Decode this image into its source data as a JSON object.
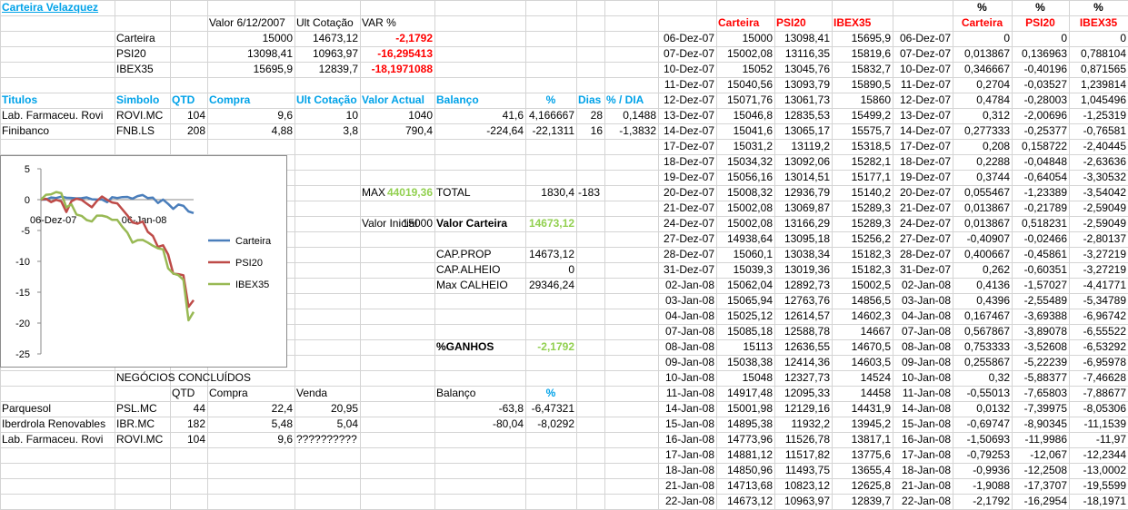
{
  "title": "Carteira Velazquez",
  "summary": {
    "headers": [
      "Valor 6/12/2007",
      "Ult Cotação",
      "VAR %"
    ],
    "rows": [
      {
        "name": "Carteira",
        "valor": "15000",
        "ult": "14673,12",
        "var": "-2,1792"
      },
      {
        "name": "PSI20",
        "valor": "13098,41",
        "ult": "10963,97",
        "var": "-16,295413"
      },
      {
        "name": "IBEX35",
        "valor": "15695,9",
        "ult": "12839,7",
        "var": "-18,1971088"
      }
    ]
  },
  "holdings": {
    "headers": [
      "Titulos",
      "Simbolo",
      "QTD",
      "Compra",
      "Ult Cotação",
      "Valor Actual",
      "Balanço",
      "%",
      "Dias",
      "% / DIA"
    ],
    "rows": [
      [
        "Lab. Farmaceu. Rovi",
        "ROVI.MC",
        "104",
        "9,6",
        "10",
        "1040",
        "41,6",
        "4,166667",
        "28",
        "0,1488"
      ],
      [
        "Finibanco",
        "FNB.LS",
        "208",
        "4,88",
        "3,8",
        "790,4",
        "-224,64",
        "-22,1311",
        "16",
        "-1,3832"
      ]
    ]
  },
  "stats": {
    "max_label": "MAX",
    "max_value": "44019,36",
    "total_label": "TOTAL",
    "total_value": "1830,4",
    "total_extra": "-183",
    "valor_inicial_label": "Valor Inicial",
    "valor_inicial": "15000",
    "valor_carteira_label": "Valor Carteira",
    "valor_carteira": "14673,12",
    "cap_prop_label": "CAP.PROP",
    "cap_prop": "14673,12",
    "cap_alheio_label": "CAP.ALHEIO",
    "cap_alheio": "0",
    "max_calheio_label": "Max CALHEIO",
    "max_calheio": "29346,24",
    "ganhos_label": "%GANHOS",
    "ganhos": "-2,1792"
  },
  "closed": {
    "title": "NEGÓCIOS CONCLUÍDOS",
    "headers": [
      "QTD",
      "Compra",
      "Venda",
      "Balanço",
      "%"
    ],
    "rows": [
      [
        "Parquesol",
        "PSL.MC",
        "44",
        "22,4",
        "20,95",
        "-63,8",
        "-6,47321"
      ],
      [
        "Iberdrola Renovables",
        "IBR.MC",
        "182",
        "5,48",
        "5,04",
        "-80,04",
        "-8,0292"
      ],
      [
        "Lab. Farmaceu. Rovi",
        "ROVI.MC",
        "104",
        "9,6",
        "??????????",
        "",
        ""
      ]
    ]
  },
  "history": {
    "headers": [
      "Carteira",
      "PSI20",
      "IBEX35"
    ],
    "pct_headers": [
      "Carteira",
      "PSI20",
      "IBEX35"
    ],
    "pct_mark": "%",
    "rows": [
      [
        "06-Dez-07",
        "15000",
        "13098,41",
        "15695,9",
        "06-Dez-07",
        "0",
        "0",
        "0"
      ],
      [
        "07-Dez-07",
        "15002,08",
        "13116,35",
        "15819,6",
        "07-Dez-07",
        "0,013867",
        "0,136963",
        "0,788104"
      ],
      [
        "10-Dez-07",
        "15052",
        "13045,76",
        "15832,7",
        "10-Dez-07",
        "0,346667",
        "-0,40196",
        "0,871565"
      ],
      [
        "11-Dez-07",
        "15040,56",
        "13093,79",
        "15890,5",
        "11-Dez-07",
        "0,2704",
        "-0,03527",
        "1,239814"
      ],
      [
        "12-Dez-07",
        "15071,76",
        "13061,73",
        "15860",
        "12-Dez-07",
        "0,4784",
        "-0,28003",
        "1,045496"
      ],
      [
        "13-Dez-07",
        "15046,8",
        "12835,53",
        "15499,2",
        "13-Dez-07",
        "0,312",
        "-2,00696",
        "-1,25319"
      ],
      [
        "14-Dez-07",
        "15041,6",
        "13065,17",
        "15575,7",
        "14-Dez-07",
        "0,277333",
        "-0,25377",
        "-0,76581"
      ],
      [
        "17-Dez-07",
        "15031,2",
        "13119,2",
        "15318,5",
        "17-Dez-07",
        "0,208",
        "0,158722",
        "-2,40445"
      ],
      [
        "18-Dez-07",
        "15034,32",
        "13092,06",
        "15282,1",
        "18-Dez-07",
        "0,2288",
        "-0,04848",
        "-2,63636"
      ],
      [
        "19-Dez-07",
        "15056,16",
        "13014,51",
        "15177,1",
        "19-Dez-07",
        "0,3744",
        "-0,64054",
        "-3,30532"
      ],
      [
        "20-Dez-07",
        "15008,32",
        "12936,79",
        "15140,2",
        "20-Dez-07",
        "0,055467",
        "-1,23389",
        "-3,54042"
      ],
      [
        "21-Dez-07",
        "15002,08",
        "13069,87",
        "15289,3",
        "21-Dez-07",
        "0,013867",
        "-0,21789",
        "-2,59049"
      ],
      [
        "24-Dez-07",
        "15002,08",
        "13166,29",
        "15289,3",
        "24-Dez-07",
        "0,013867",
        "0,518231",
        "-2,59049"
      ],
      [
        "27-Dez-07",
        "14938,64",
        "13095,18",
        "15256,2",
        "27-Dez-07",
        "-0,40907",
        "-0,02466",
        "-2,80137"
      ],
      [
        "28-Dez-07",
        "15060,1",
        "13038,34",
        "15182,3",
        "28-Dez-07",
        "0,400667",
        "-0,45861",
        "-3,27219"
      ],
      [
        "31-Dez-07",
        "15039,3",
        "13019,36",
        "15182,3",
        "31-Dez-07",
        "0,262",
        "-0,60351",
        "-3,27219"
      ],
      [
        "02-Jan-08",
        "15062,04",
        "12892,73",
        "15002,5",
        "02-Jan-08",
        "0,4136",
        "-1,57027",
        "-4,41771"
      ],
      [
        "03-Jan-08",
        "15065,94",
        "12763,76",
        "14856,5",
        "03-Jan-08",
        "0,4396",
        "-2,55489",
        "-5,34789"
      ],
      [
        "04-Jan-08",
        "15025,12",
        "12614,57",
        "14602,3",
        "04-Jan-08",
        "0,167467",
        "-3,69388",
        "-6,96742"
      ],
      [
        "07-Jan-08",
        "15085,18",
        "12588,78",
        "14667",
        "07-Jan-08",
        "0,567867",
        "-3,89078",
        "-6,55522"
      ],
      [
        "08-Jan-08",
        "15113",
        "12636,55",
        "14670,5",
        "08-Jan-08",
        "0,753333",
        "-3,52608",
        "-6,53292"
      ],
      [
        "09-Jan-08",
        "15038,38",
        "12414,36",
        "14603,5",
        "09-Jan-08",
        "0,255867",
        "-5,22239",
        "-6,95978"
      ],
      [
        "10-Jan-08",
        "15048",
        "12327,73",
        "14524",
        "10-Jan-08",
        "0,32",
        "-5,88377",
        "-7,46628"
      ],
      [
        "11-Jan-08",
        "14917,48",
        "12095,33",
        "14458",
        "11-Jan-08",
        "-0,55013",
        "-7,65803",
        "-7,88677"
      ],
      [
        "14-Jan-08",
        "15001,98",
        "12129,16",
        "14431,9",
        "14-Jan-08",
        "0,0132",
        "-7,39975",
        "-8,05306"
      ],
      [
        "15-Jan-08",
        "14895,38",
        "11932,2",
        "13945,2",
        "15-Jan-08",
        "-0,69747",
        "-8,90345",
        "-11,1539"
      ],
      [
        "16-Jan-08",
        "14773,96",
        "11526,78",
        "13817,1",
        "16-Jan-08",
        "-1,50693",
        "-11,9986",
        "-11,97"
      ],
      [
        "17-Jan-08",
        "14881,12",
        "11517,82",
        "13775,6",
        "17-Jan-08",
        "-0,79253",
        "-12,067",
        "-12,2344"
      ],
      [
        "18-Jan-08",
        "14850,96",
        "11493,75",
        "13655,4",
        "18-Jan-08",
        "-0,9936",
        "-12,2508",
        "-13,0002"
      ],
      [
        "21-Jan-08",
        "14713,68",
        "10823,12",
        "12625,8",
        "21-Jan-08",
        "-1,9088",
        "-17,3707",
        "-19,5599"
      ],
      [
        "22-Jan-08",
        "14673,12",
        "10963,97",
        "12839,7",
        "22-Jan-08",
        "-2,1792",
        "-16,2954",
        "-18,1971"
      ]
    ]
  },
  "chart_data": {
    "type": "line",
    "x": [
      "06-Dez-07",
      "07-Dez-07",
      "10-Dez-07",
      "11-Dez-07",
      "12-Dez-07",
      "13-Dez-07",
      "14-Dez-07",
      "17-Dez-07",
      "18-Dez-07",
      "19-Dez-07",
      "20-Dez-07",
      "21-Dez-07",
      "24-Dez-07",
      "27-Dez-07",
      "28-Dez-07",
      "31-Dez-07",
      "02-Jan-08",
      "03-Jan-08",
      "04-Jan-08",
      "07-Jan-08",
      "08-Jan-08",
      "09-Jan-08",
      "10-Jan-08",
      "11-Jan-08",
      "14-Jan-08",
      "15-Jan-08",
      "16-Jan-08",
      "17-Jan-08",
      "18-Jan-08",
      "21-Jan-08",
      "22-Jan-08"
    ],
    "tick_labels": [
      "06-Dez-07",
      "06-Jan-08"
    ],
    "series": [
      {
        "name": "Carteira",
        "color": "#4a7ebb",
        "values": [
          0,
          0.013867,
          0.346667,
          0.2704,
          0.4784,
          0.312,
          0.277333,
          0.208,
          0.2288,
          0.3744,
          0.055467,
          0.013867,
          0.013867,
          -0.40907,
          0.400667,
          0.262,
          0.4136,
          0.4396,
          0.167467,
          0.567867,
          0.753333,
          0.255867,
          0.32,
          -0.55013,
          0.0132,
          -0.69747,
          -1.50693,
          -0.79253,
          -0.9936,
          -1.9088,
          -2.1792
        ]
      },
      {
        "name": "PSI20",
        "color": "#be4b48",
        "values": [
          0,
          0.136963,
          -0.40196,
          -0.03527,
          -0.28003,
          -2.00696,
          -0.25377,
          0.158722,
          -0.04848,
          -0.64054,
          -1.23389,
          -0.21789,
          0.518231,
          -0.02466,
          -0.45861,
          -0.60351,
          -1.57027,
          -2.55489,
          -3.69388,
          -3.89078,
          -3.52608,
          -5.22239,
          -5.88377,
          -7.65803,
          -7.39975,
          -8.90345,
          -11.9986,
          -12.067,
          -12.2508,
          -17.3707,
          -16.2954
        ]
      },
      {
        "name": "IBEX35",
        "color": "#98b954",
        "values": [
          0,
          0.788104,
          0.871565,
          1.239814,
          1.045496,
          -1.25319,
          -0.76581,
          -2.40445,
          -2.63636,
          -3.30532,
          -3.54042,
          -2.59049,
          -2.59049,
          -2.80137,
          -3.27219,
          -3.27219,
          -4.41771,
          -5.34789,
          -6.96742,
          -6.55522,
          -6.53292,
          -6.95978,
          -7.46628,
          -7.88677,
          -8.05306,
          -11.1539,
          -11.97,
          -12.2344,
          -13.0002,
          -19.5599,
          -18.1971
        ]
      }
    ],
    "ylim": [
      -25,
      5
    ],
    "yticks": [
      "5",
      "0",
      "-5",
      "-10",
      "-15",
      "-20",
      "-25"
    ],
    "grid": false,
    "legend": "right"
  }
}
